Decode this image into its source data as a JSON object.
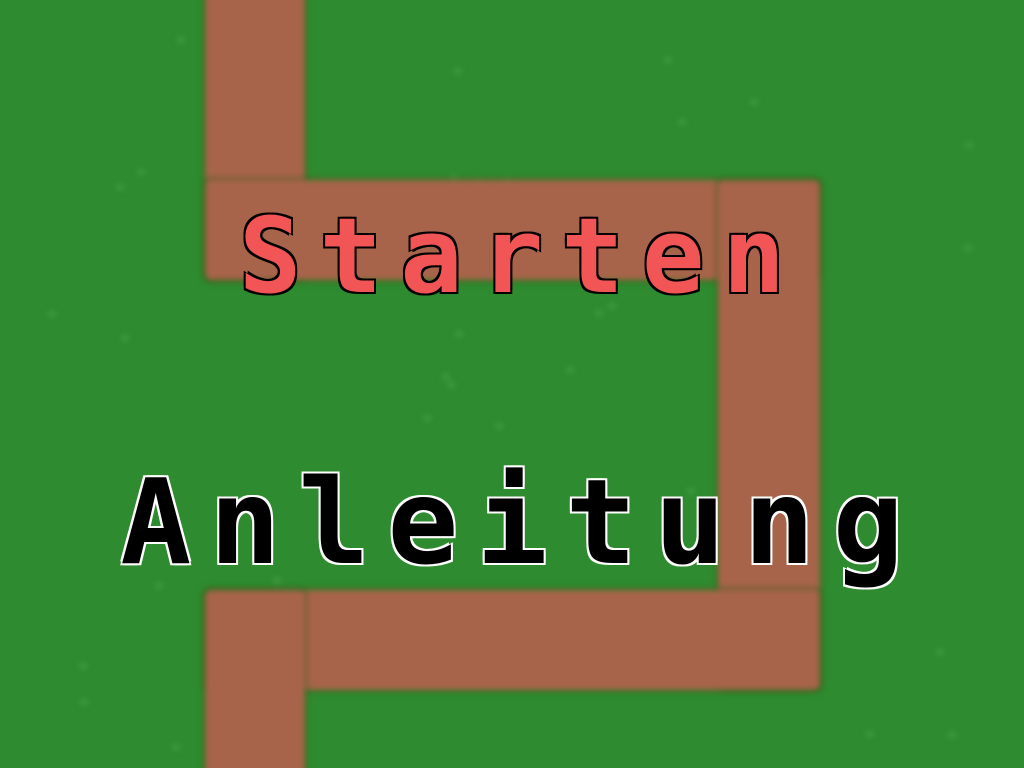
{
  "menu": {
    "start_label": "Starten",
    "guide_label": "Anleitung"
  },
  "colors": {
    "grass": "#2f8b2f",
    "grass_speck": "#3f9c3f",
    "path": "#a8644a",
    "start_text": "#f25555",
    "guide_text": "#000000",
    "text_outline_start": "#000000",
    "text_outline_guide": "#ffffff"
  }
}
